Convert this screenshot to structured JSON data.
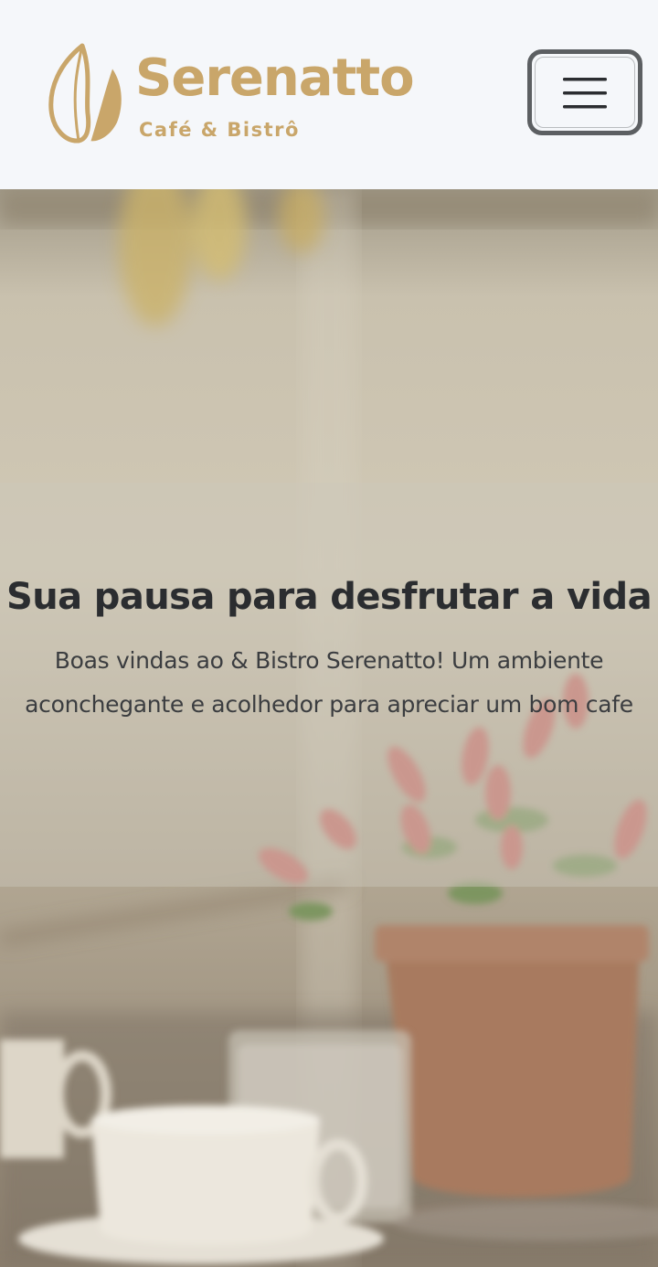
{
  "navbar": {
    "brand_name": "Serenatto",
    "brand_tagline": "Café & Bistrô",
    "menu_icon": "hamburger-menu-icon"
  },
  "hero": {
    "title": "Sua pausa para desfrutar a vida",
    "text": "Boas vindas ao & Bistro Serenatto! Um ambiente aconchegante e acolhedor para apreciar um bom cafe"
  },
  "colors": {
    "brand_gold": "#c9a66a",
    "navbar_bg": "#f5f7fa",
    "toggler_border": "#5c5f62",
    "heading_text": "#2b2d30",
    "body_text": "#3b3d40"
  }
}
